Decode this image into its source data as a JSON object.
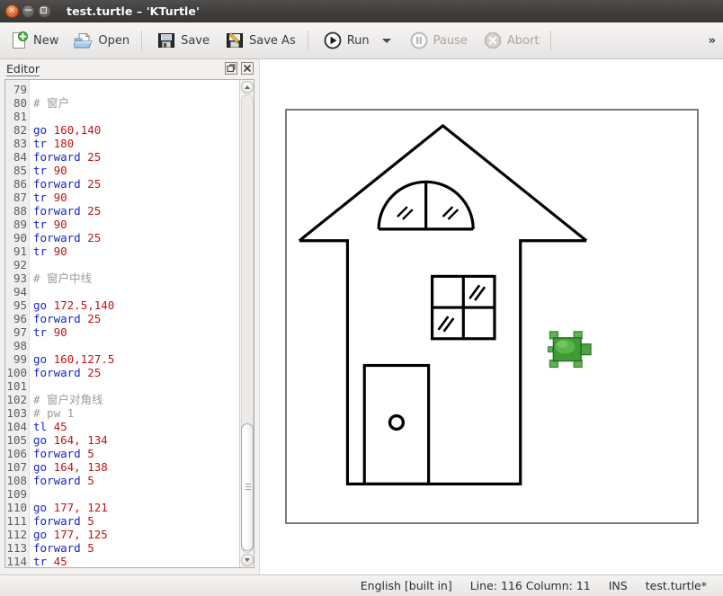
{
  "window": {
    "title": "test.turtle – 'KTurtle'",
    "close_label": "×",
    "minimize_label": "–",
    "maximize_label": ""
  },
  "toolbar": {
    "new_label": "New",
    "open_label": "Open",
    "save_label": "Save",
    "save_as_label": "Save As",
    "run_label": "Run",
    "pause_label": "Pause",
    "abort_label": "Abort",
    "overflow_label": "»"
  },
  "editor_dock": {
    "title": "Editor",
    "float_button": "float-editor",
    "close_button": "close-editor"
  },
  "statusbar": {
    "language": "English [built in]",
    "position": "Line: 116 Column: 11",
    "insert_mode": "INS",
    "filename": "test.turtle*"
  },
  "colors": {
    "keyword": "#1425c4",
    "number": "#c01414",
    "comment": "#9b9b9b",
    "titlebar": "#403e3c",
    "close_button": "#e8703a",
    "turtle_green": "#3f9c35",
    "canvas_border": "#7b7b7b"
  },
  "code": {
    "first_line": 79,
    "lines": [
      {
        "n": 79,
        "tokens": []
      },
      {
        "n": 80,
        "tokens": [
          {
            "t": "com",
            "v": "# 窗户"
          }
        ]
      },
      {
        "n": 81,
        "tokens": []
      },
      {
        "n": 82,
        "tokens": [
          {
            "t": "cmd",
            "v": "go"
          },
          {
            "t": "txt",
            "v": " "
          },
          {
            "t": "num",
            "v": "160,140"
          }
        ]
      },
      {
        "n": 83,
        "tokens": [
          {
            "t": "cmd",
            "v": "tr"
          },
          {
            "t": "txt",
            "v": " "
          },
          {
            "t": "num",
            "v": "180"
          }
        ]
      },
      {
        "n": 84,
        "tokens": [
          {
            "t": "cmd",
            "v": "forward"
          },
          {
            "t": "txt",
            "v": " "
          },
          {
            "t": "num",
            "v": "25"
          }
        ]
      },
      {
        "n": 85,
        "tokens": [
          {
            "t": "cmd",
            "v": "tr"
          },
          {
            "t": "txt",
            "v": " "
          },
          {
            "t": "num",
            "v": "90"
          }
        ]
      },
      {
        "n": 86,
        "tokens": [
          {
            "t": "cmd",
            "v": "forward"
          },
          {
            "t": "txt",
            "v": " "
          },
          {
            "t": "num",
            "v": "25"
          }
        ]
      },
      {
        "n": 87,
        "tokens": [
          {
            "t": "cmd",
            "v": "tr"
          },
          {
            "t": "txt",
            "v": " "
          },
          {
            "t": "num",
            "v": "90"
          }
        ]
      },
      {
        "n": 88,
        "tokens": [
          {
            "t": "cmd",
            "v": "forward"
          },
          {
            "t": "txt",
            "v": " "
          },
          {
            "t": "num",
            "v": "25"
          }
        ]
      },
      {
        "n": 89,
        "tokens": [
          {
            "t": "cmd",
            "v": "tr"
          },
          {
            "t": "txt",
            "v": " "
          },
          {
            "t": "num",
            "v": "90"
          }
        ]
      },
      {
        "n": 90,
        "tokens": [
          {
            "t": "cmd",
            "v": "forward"
          },
          {
            "t": "txt",
            "v": " "
          },
          {
            "t": "num",
            "v": "25"
          }
        ]
      },
      {
        "n": 91,
        "tokens": [
          {
            "t": "cmd",
            "v": "tr"
          },
          {
            "t": "txt",
            "v": " "
          },
          {
            "t": "num",
            "v": "90"
          }
        ]
      },
      {
        "n": 92,
        "tokens": []
      },
      {
        "n": 93,
        "tokens": [
          {
            "t": "com",
            "v": "# 窗户中线"
          }
        ]
      },
      {
        "n": 94,
        "tokens": []
      },
      {
        "n": 95,
        "tokens": [
          {
            "t": "cmd",
            "v": "go"
          },
          {
            "t": "txt",
            "v": " "
          },
          {
            "t": "num",
            "v": "172.5,140"
          }
        ]
      },
      {
        "n": 96,
        "tokens": [
          {
            "t": "cmd",
            "v": "forward"
          },
          {
            "t": "txt",
            "v": " "
          },
          {
            "t": "num",
            "v": "25"
          }
        ]
      },
      {
        "n": 97,
        "tokens": [
          {
            "t": "cmd",
            "v": "tr"
          },
          {
            "t": "txt",
            "v": " "
          },
          {
            "t": "num",
            "v": "90"
          }
        ]
      },
      {
        "n": 98,
        "tokens": []
      },
      {
        "n": 99,
        "tokens": [
          {
            "t": "cmd",
            "v": "go"
          },
          {
            "t": "txt",
            "v": " "
          },
          {
            "t": "num",
            "v": "160,127.5"
          }
        ]
      },
      {
        "n": 100,
        "tokens": [
          {
            "t": "cmd",
            "v": "forward"
          },
          {
            "t": "txt",
            "v": " "
          },
          {
            "t": "num",
            "v": "25"
          }
        ]
      },
      {
        "n": 101,
        "tokens": []
      },
      {
        "n": 102,
        "tokens": [
          {
            "t": "com",
            "v": "# 窗户对角线"
          }
        ]
      },
      {
        "n": 103,
        "tokens": [
          {
            "t": "com",
            "v": "# pw 1"
          }
        ]
      },
      {
        "n": 104,
        "tokens": [
          {
            "t": "cmd",
            "v": "tl"
          },
          {
            "t": "txt",
            "v": " "
          },
          {
            "t": "num",
            "v": "45"
          }
        ]
      },
      {
        "n": 105,
        "tokens": [
          {
            "t": "cmd",
            "v": "go"
          },
          {
            "t": "txt",
            "v": " "
          },
          {
            "t": "num",
            "v": "164, 134"
          }
        ]
      },
      {
        "n": 106,
        "tokens": [
          {
            "t": "cmd",
            "v": "forward"
          },
          {
            "t": "txt",
            "v": " "
          },
          {
            "t": "num",
            "v": "5"
          }
        ]
      },
      {
        "n": 107,
        "tokens": [
          {
            "t": "cmd",
            "v": "go"
          },
          {
            "t": "txt",
            "v": " "
          },
          {
            "t": "num",
            "v": "164, 138"
          }
        ]
      },
      {
        "n": 108,
        "tokens": [
          {
            "t": "cmd",
            "v": "forward"
          },
          {
            "t": "txt",
            "v": " "
          },
          {
            "t": "num",
            "v": "5"
          }
        ]
      },
      {
        "n": 109,
        "tokens": []
      },
      {
        "n": 110,
        "tokens": [
          {
            "t": "cmd",
            "v": "go"
          },
          {
            "t": "txt",
            "v": " "
          },
          {
            "t": "num",
            "v": "177, 121"
          }
        ]
      },
      {
        "n": 111,
        "tokens": [
          {
            "t": "cmd",
            "v": "forward"
          },
          {
            "t": "txt",
            "v": " "
          },
          {
            "t": "num",
            "v": "5"
          }
        ]
      },
      {
        "n": 112,
        "tokens": [
          {
            "t": "cmd",
            "v": "go"
          },
          {
            "t": "txt",
            "v": " "
          },
          {
            "t": "num",
            "v": "177, 125"
          }
        ]
      },
      {
        "n": 113,
        "tokens": [
          {
            "t": "cmd",
            "v": "forward"
          },
          {
            "t": "txt",
            "v": " "
          },
          {
            "t": "num",
            "v": "5"
          }
        ]
      },
      {
        "n": 114,
        "tokens": [
          {
            "t": "cmd",
            "v": "tr"
          },
          {
            "t": "txt",
            "v": " "
          },
          {
            "t": "num",
            "v": "45"
          }
        ]
      }
    ]
  },
  "drawing": {
    "description": "house-with-roof-door-and-windows",
    "turtle_position": "right-of-house"
  }
}
